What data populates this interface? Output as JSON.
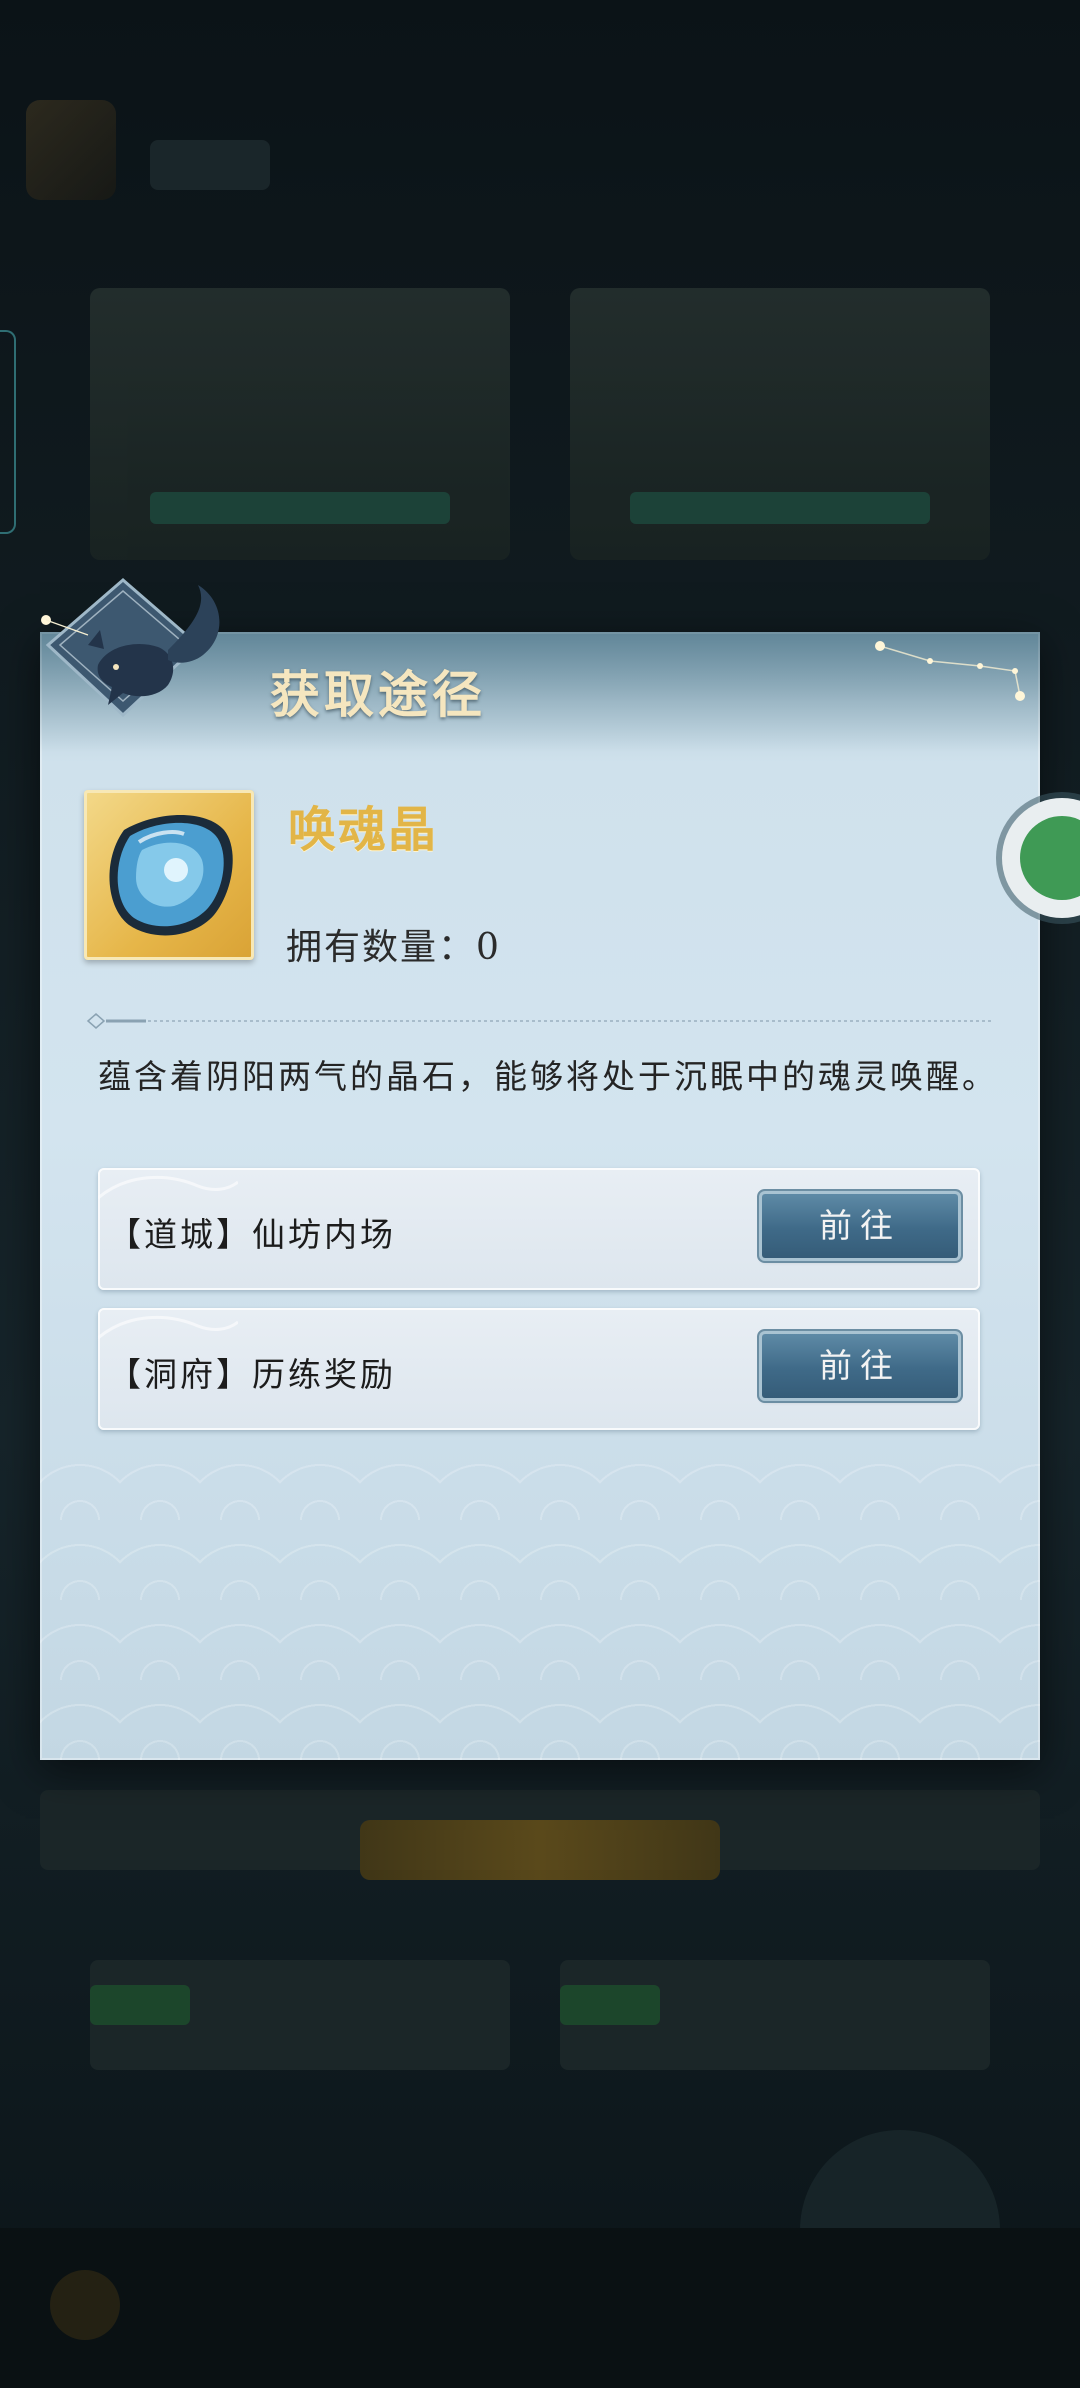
{
  "dialog": {
    "title": "获取途径",
    "item": {
      "name": "唤魂晶",
      "owned_label": "拥有数量：",
      "owned_count": "0",
      "icon": "blue-crystal-icon"
    },
    "description": "蕴含着阴阳两气的晶石，能够将处于沉眠中的魂灵唤醒。",
    "routes": [
      {
        "label": "【道城】仙坊内场",
        "button": "前往"
      },
      {
        "label": "【洞府】历练奖励",
        "button": "前往"
      }
    ]
  },
  "colors": {
    "title": "#f5e6bf",
    "item_name": "#e2b547",
    "button": "#3f6a88",
    "chat_bubble": "#3f9a55"
  },
  "floating": {
    "icon": "chat-bubble-icon"
  }
}
